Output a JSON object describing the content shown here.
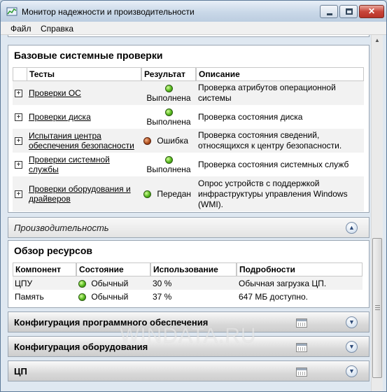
{
  "window": {
    "title": "Монитор надежности и производительности"
  },
  "menu": [
    "Файл",
    "Справка"
  ],
  "basic_checks": {
    "title": "Базовые системные проверки",
    "columns": [
      "Тесты",
      "Результат",
      "Описание"
    ],
    "rows": [
      {
        "test": "Проверки ОС",
        "result": "Выполнена",
        "status": "ok",
        "description": "Проверка атрибутов операционной системы"
      },
      {
        "test": "Проверки диска",
        "result": "Выполнена",
        "status": "ok",
        "description": "Проверка состояния диска"
      },
      {
        "test": "Испытания центра обеспечения безопасности",
        "result": "Ошибка",
        "status": "error",
        "description": "Проверка состояния сведений, относящихся к центру безопасности."
      },
      {
        "test": "Проверки системной службы",
        "result": "Выполнена",
        "status": "ok",
        "description": "Проверка состояния системных служб"
      },
      {
        "test": "Проверки оборудования и драйверов",
        "result": "Передан",
        "status": "ok",
        "description": "Опрос устройств с поддержкой инфраструктуры управления Windows (WMI)."
      }
    ]
  },
  "performance": {
    "title": "Производительность"
  },
  "resources": {
    "title": "Обзор ресурсов",
    "columns": [
      "Компонент",
      "Состояние",
      "Использование",
      "Подробности"
    ],
    "rows": [
      {
        "component": "ЦПУ",
        "state": "Обычный",
        "usage": "30 %",
        "details": "Обычная загрузка ЦП."
      },
      {
        "component": "Память",
        "state": "Обычный",
        "usage": "37 %",
        "details": "647 МБ доступно."
      }
    ]
  },
  "sections": [
    {
      "title": "Конфигурация программного обеспечения"
    },
    {
      "title": "Конфигурация оборудования"
    },
    {
      "title": "ЦП"
    }
  ],
  "watermark": "WINDATA.RU",
  "colors": {
    "ok": "#56b81d",
    "error": "#b2511d",
    "close_button": "#c8453a"
  }
}
